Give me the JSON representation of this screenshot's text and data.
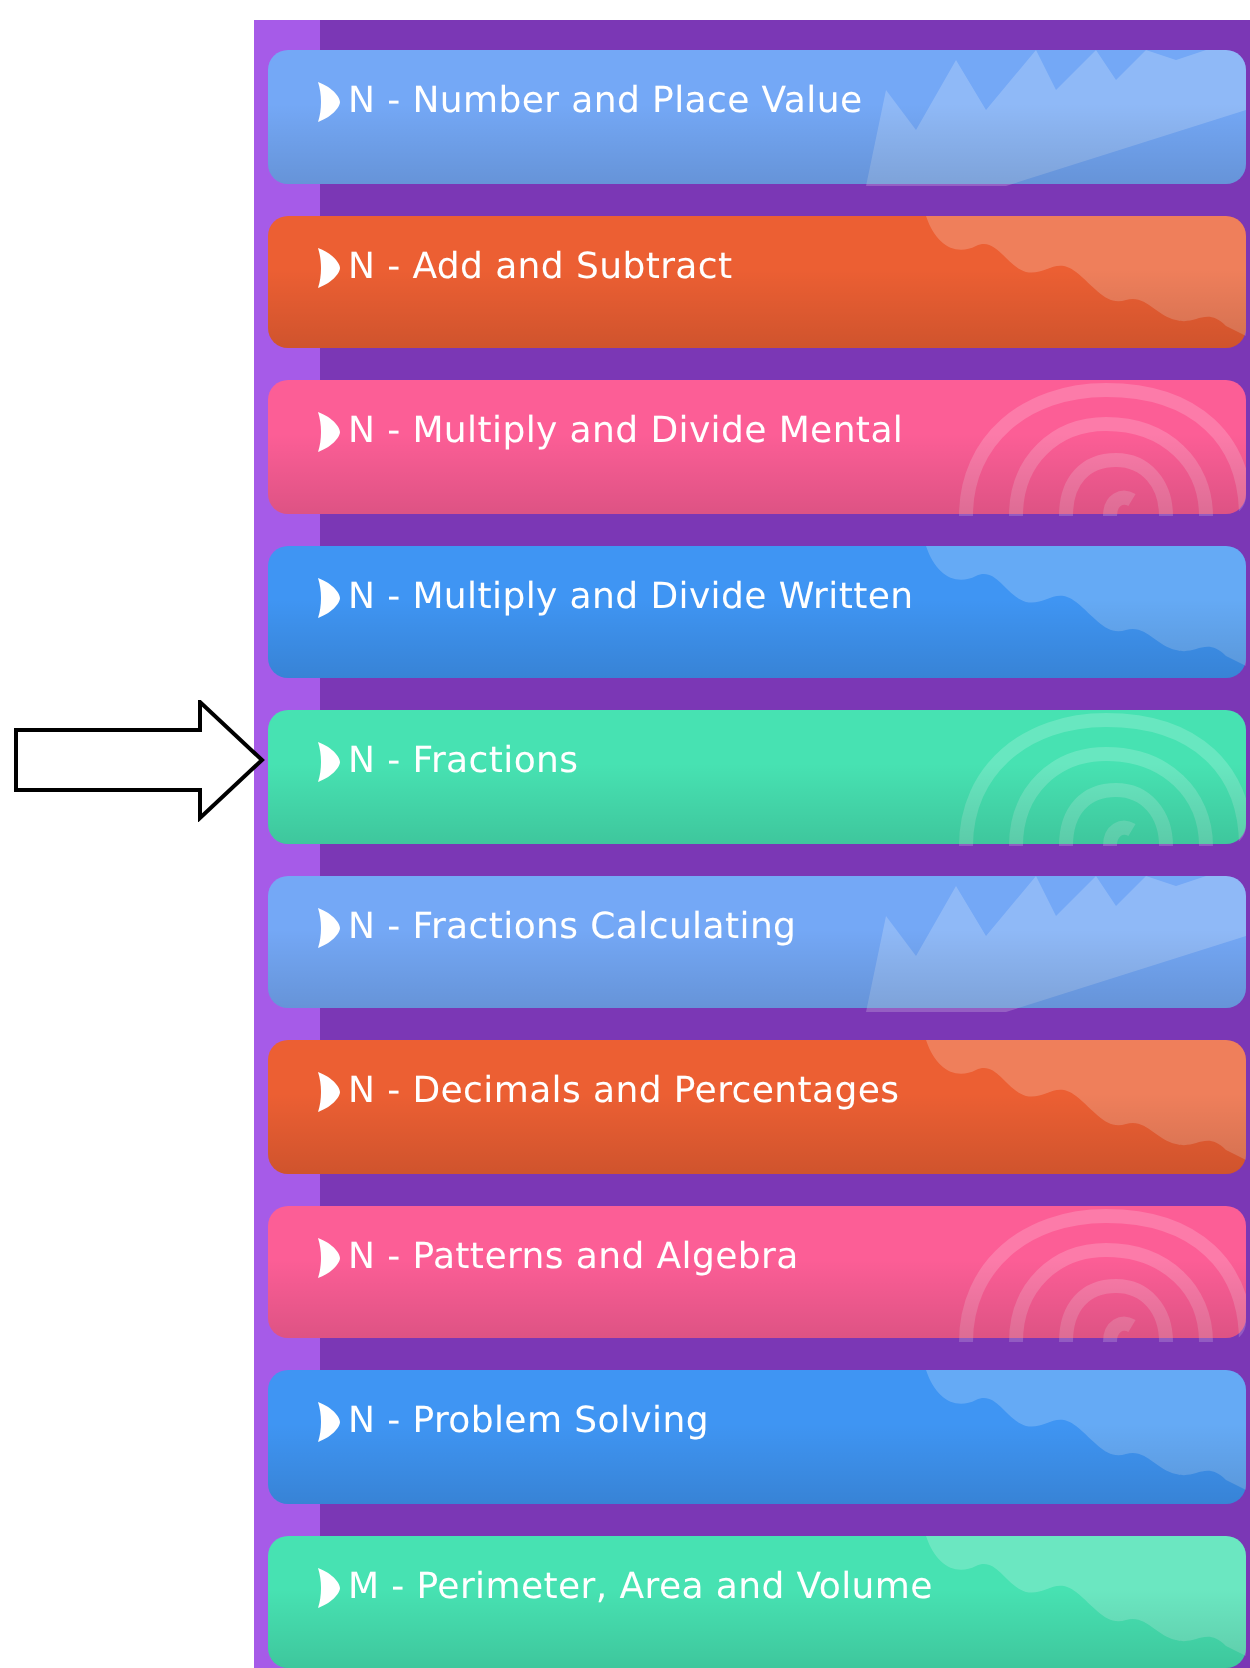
{
  "topics": [
    {
      "label": "N - Number and Place Value",
      "color": "#74a8f6",
      "kind": "zigzag",
      "pointed": false
    },
    {
      "label": "N - Add and Subtract",
      "color": "#ec5f33",
      "kind": "wave",
      "pointed": false
    },
    {
      "label": "N - Multiply and Divide Mental",
      "color": "#fc5e96",
      "kind": "spiral",
      "pointed": false
    },
    {
      "label": "N - Multiply and Divide Written",
      "color": "#3f95f3",
      "kind": "wave",
      "pointed": false
    },
    {
      "label": "N - Fractions",
      "color": "#47e2b2",
      "kind": "spiral",
      "pointed": true
    },
    {
      "label": "N - Fractions Calculating",
      "color": "#74a8f6",
      "kind": "zigzag",
      "pointed": false
    },
    {
      "label": "N - Decimals and Percentages",
      "color": "#ec5f33",
      "kind": "wave",
      "pointed": false
    },
    {
      "label": "N - Patterns and Algebra",
      "color": "#fc5e96",
      "kind": "spiral",
      "pointed": false
    },
    {
      "label": "N - Problem Solving",
      "color": "#3f95f3",
      "kind": "wave",
      "pointed": false
    },
    {
      "label": "M - Perimeter, Area and Volume",
      "color": "#47e2b2",
      "kind": "wave",
      "pointed": false
    }
  ]
}
